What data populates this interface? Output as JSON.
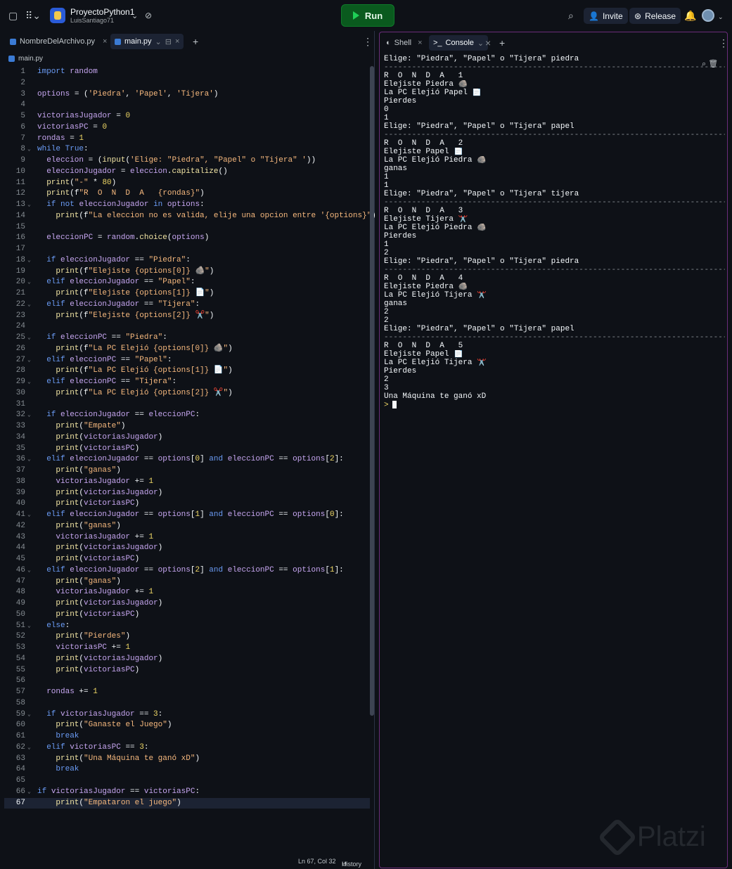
{
  "topbar": {
    "project_name": "ProyectoPython1",
    "user": "LuisSantiago71",
    "run_label": "Run",
    "invite_label": "Invite",
    "release_label": "Release"
  },
  "editor": {
    "tabs": [
      {
        "label": "NombreDelArchivo.py"
      },
      {
        "label": "main.py"
      }
    ],
    "breadcrumb": "main.py",
    "status_position": "Ln 67, Col 32",
    "status_history": "History"
  },
  "code_lines": [
    "import random",
    "",
    "options = ('Piedra', 'Papel', 'Tijera')",
    "",
    "victoriasJugador = 0",
    "victoriasPC = 0",
    "rondas = 1",
    "while True:",
    "  eleccion = (input('Elige: \"Piedra\", \"Papel\" o \"Tijera\" '))",
    "  eleccionJugador = eleccion.capitalize()",
    "  print(\"-\" * 80)",
    "  print(f\"R  O  N  D  A   {rondas}\")",
    "  if not eleccionJugador in options:",
    "    print(f\"La eleccion no es valida, elije una opcion entre '{options}\")",
    "",
    "  eleccionPC = random.choice(options)",
    "",
    "  if eleccionJugador == \"Piedra\":",
    "    print(f\"Elejiste {options[0]} 🪨\")",
    "  elif eleccionJugador == \"Papel\":",
    "    print(f\"Elejiste {options[1]} 📄\")",
    "  elif eleccionJugador == \"Tijera\":",
    "    print(f\"Elejiste {options[2]} ✂️\")",
    "",
    "  if eleccionPC == \"Piedra\":",
    "    print(f\"La PC Elejió {options[0]} 🪨\")",
    "  elif eleccionPC == \"Papel\":",
    "    print(f\"La PC Elejió {options[1]} 📄\")",
    "  elif eleccionPC == \"Tijera\":",
    "    print(f\"La PC Elejió {options[2]} ✂️\")",
    "",
    "  if eleccionJugador == eleccionPC:",
    "    print(\"Empate\")",
    "    print(victoriasJugador)",
    "    print(victoriasPC)",
    "  elif eleccionJugador == options[0] and eleccionPC == options[2]:",
    "    print(\"ganas\")",
    "    victoriasJugador += 1",
    "    print(victoriasJugador)",
    "    print(victoriasPC)",
    "  elif eleccionJugador == options[1] and eleccionPC == options[0]:",
    "    print(\"ganas\")",
    "    victoriasJugador += 1",
    "    print(victoriasJugador)",
    "    print(victoriasPC)",
    "  elif eleccionJugador == options[2] and eleccionPC == options[1]:",
    "    print(\"ganas\")",
    "    victoriasJugador += 1",
    "    print(victoriasJugador)",
    "    print(victoriasPC)",
    "  else:",
    "    print(\"Pierdes\")",
    "    victoriasPC += 1",
    "    print(victoriasJugador)",
    "    print(victoriasPC)",
    "",
    "  rondas += 1",
    "",
    "  if victoriasJugador == 3:",
    "    print(\"Ganaste el Juego\")",
    "    break",
    "  elif victoriasPC == 3:",
    "    print(\"Una Máquina te ganó xD\")",
    "    break",
    "",
    "if victoriasJugador == victoriasPC:",
    "    print(\"Empataron el juego\")"
  ],
  "console": {
    "tabs": [
      {
        "label": "Shell"
      },
      {
        "label": "Console"
      }
    ],
    "lines": [
      "Elige: \"Piedra\", \"Papel\" o \"Tijera\" piedra",
      "--------------------------------------------------------------------------------",
      "R  O  N  D  A   1",
      "Elejiste Piedra 🪨",
      "La PC Elejió Papel 📄",
      "Pierdes",
      "0",
      "1",
      "Elige: \"Piedra\", \"Papel\" o \"Tijera\" papel",
      "--------------------------------------------------------------------------------",
      "R  O  N  D  A   2",
      "Elejiste Papel 📄",
      "La PC Elejió Piedra 🪨",
      "ganas",
      "1",
      "1",
      "Elige: \"Piedra\", \"Papel\" o \"Tijera\" tijera",
      "--------------------------------------------------------------------------------",
      "R  O  N  D  A   3",
      "Elejiste Tijera ✂️",
      "La PC Elejió Piedra 🪨",
      "Pierdes",
      "1",
      "2",
      "Elige: \"Piedra\", \"Papel\" o \"Tijera\" piedra",
      "--------------------------------------------------------------------------------",
      "R  O  N  D  A   4",
      "Elejiste Piedra 🪨",
      "La PC Elejió Tijera ✂️",
      "ganas",
      "2",
      "2",
      "Elige: \"Piedra\", \"Papel\" o \"Tijera\" papel",
      "--------------------------------------------------------------------------------",
      "R  O  N  D  A   5",
      "Elejiste Papel 📄",
      "La PC Elejió Tijera ✂️",
      "Pierdes",
      "2",
      "3",
      "Una Máquina te ganó xD"
    ],
    "prompt": ">"
  },
  "watermark": "Platzi"
}
